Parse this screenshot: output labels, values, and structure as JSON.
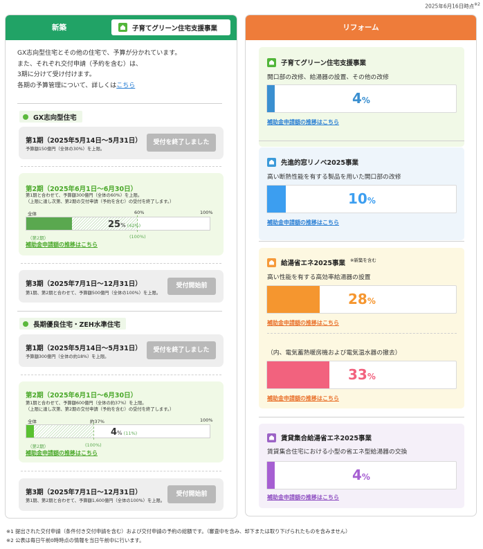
{
  "timestamp": "2025年6月16日時点",
  "timestamp_note": "※2",
  "left": {
    "title": "新築",
    "badge_label": "子育てグリーン住宅支援事業",
    "intro_lines": [
      "GX志向型住宅とその他の住宅で、予算が分かれています。",
      "また、それぞれ交付申請（予約を含む）は、",
      "3期に分けて受け付けます。"
    ],
    "intro_last_prefix": "各期の予算管理について、詳しくは",
    "intro_last_link": "こちら",
    "sections": [
      {
        "label": "GX志向型住宅",
        "periods": [
          {
            "title": "第1期（2025年5月14日～5月31日）",
            "note_lines": [
              "予算額150億円（全体の30%）を上限。"
            ],
            "button": "受付を終了しました"
          },
          {
            "title": "第2期（2025年6月1日～6月30日）",
            "note_lines": [
              "第1期と合わせて、予算額300億円（全体の60%）を上限。",
              "（上限に達し次第、第2期の交付申請（予約を含む）の受付を終了します。）"
            ],
            "progress": 25,
            "threshold": 42,
            "bar_left_label": "全体",
            "bar_mid_label": "60%",
            "bar_right_label": "100%",
            "pct_text": "25",
            "pct_unit": "%",
            "pct_sub": "(42%)",
            "below_left": "（第2期）",
            "below_mid": "(100%)",
            "link": "補助金申請額の推移はこちら"
          },
          {
            "title": "第3期（2025年7月1日～12月31日）",
            "note_lines": [
              "第1期、第2期と合わせて、予算額500億円（全体の100%）を上限。"
            ],
            "button": "受付開始前"
          }
        ]
      },
      {
        "label": "長期優良住宅・ZEH水準住宅",
        "periods": [
          {
            "title": "第1期（2025年5月14日～5月31日）",
            "note_lines": [
              "予算額300億円（全体の約18%）を上限。"
            ],
            "button": "受付を終了しました"
          },
          {
            "title": "第2期（2025年6月1日～6月30日）",
            "note_lines": [
              "第1期と合わせて、予算額600億円（全体の約37%）を上限。",
              "（上限に達し次第、第2期の交付申請（予約を含む）の受付を終了します。）"
            ],
            "progress": 4,
            "threshold": 37,
            "bar_left_label": "全体",
            "bar_mid_label": "約37%",
            "bar_right_label": "100%",
            "pct_text": "4",
            "pct_unit": "%",
            "pct_sub": "(11%)",
            "below_left": "（第2期）",
            "below_mid": "(100%)",
            "link": "補助金申請額の推移はこちら"
          },
          {
            "title": "第3期（2025年7月1日～12月31日）",
            "note_lines": [
              "第1期、第2期と合わせて、予算額1,600億円（全体の100%）を上限。"
            ],
            "button": "受付開始前"
          }
        ]
      }
    ]
  },
  "right": {
    "title": "リフォーム",
    "cards": [
      {
        "title": "子育てグリーン住宅支援事業",
        "desc": "開口部の改修、給湯器の設置、その他の改修",
        "progress": 4,
        "pct_text": "4",
        "pct_unit": "%",
        "color": "#3a8fd0",
        "link": "補助金申請額の推移はこちら",
        "link_color": "#2a7fd4"
      },
      {
        "title": "先進的窓リノベ2025事業",
        "desc": "高い断熱性能を有する製品を用いた開口部の改修",
        "progress": 10,
        "pct_text": "10",
        "pct_unit": "%",
        "color": "#3c9ef0",
        "link": "補助金申請額の推移はこちら",
        "link_color": "#2a7fd4"
      },
      {
        "title": "給湯省エネ2025事業",
        "title_note": "※新築を含む",
        "desc": "高い性能を有する高効率給湯器の設置",
        "progress": 28,
        "pct_text": "28",
        "pct_unit": "%",
        "color": "#f5962f",
        "link": "補助金申請額の推移はこちら",
        "link_color": "#e9702a",
        "sub": {
          "desc": "（内、電気蓄熱暖房機および電気温水器の撤去）",
          "progress": 33,
          "pct_text": "33",
          "pct_unit": "%",
          "color": "#f2627e",
          "link": "補助金申請額の推移はこちら",
          "link_color": "#e9702a"
        }
      },
      {
        "title": "賃貸集合給湯省エネ2025事業",
        "desc": "賃貸集合住宅における小型の省エネ型給湯器の交換",
        "progress": 4,
        "pct_text": "4",
        "pct_unit": "%",
        "color": "#a65fd2",
        "link": "補助金申請額の推移はこちら",
        "link_color": "#8f4fc2"
      }
    ]
  },
  "footnotes": [
    "※1 提出された交付申請（条件付き交付申請を含む）および交付申請の予約の総額です。（審査中を含み、却下または取り下げられたものを含みません）",
    "※2 公表は毎日午前0時時点の情報を当日午前中に行います。"
  ],
  "colors": {
    "left_header": "#21a366",
    "right_header": "#ee7c3a",
    "progress_green": "#5aa84f",
    "button_grey": "#b9b9b9"
  },
  "icons": [
    "house-icon",
    "dot-icon"
  ]
}
